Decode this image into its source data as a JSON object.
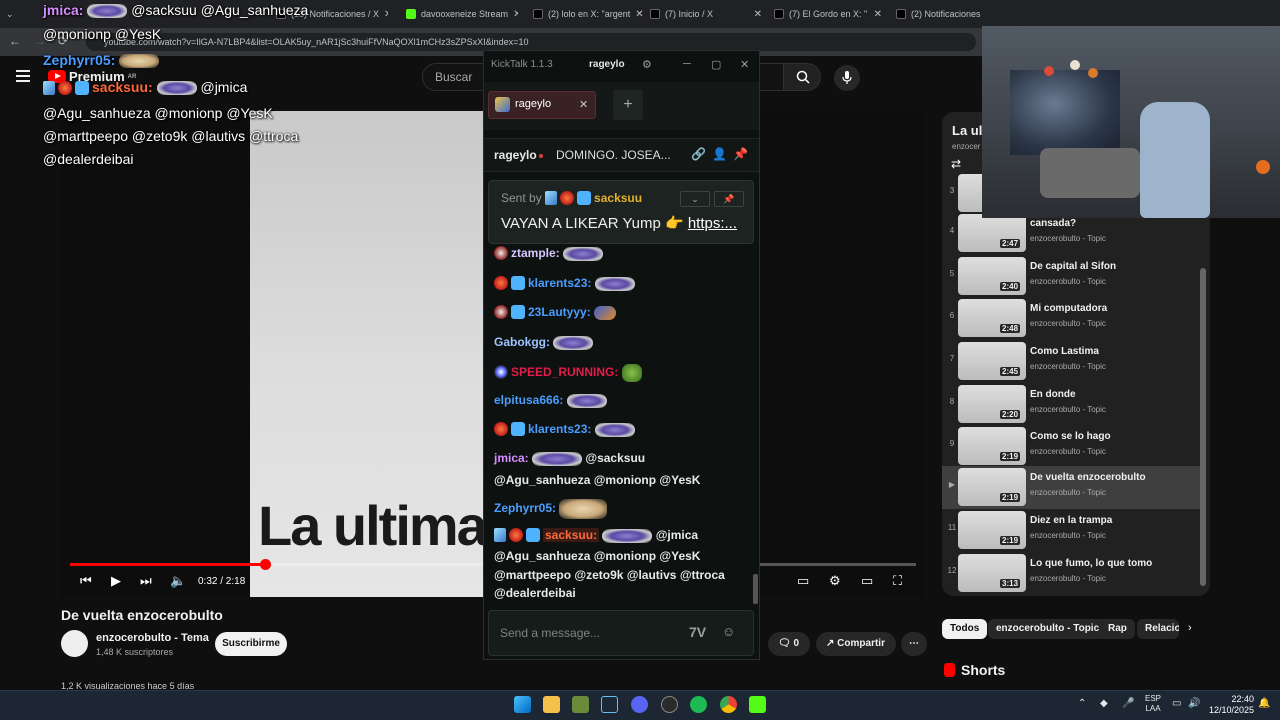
{
  "browser": {
    "tabs": [
      {
        "label": "(2) lolo en X: \"argent",
        "color": "#1d1d1d"
      },
      {
        "label": "(7) Inicio / X",
        "color": "#1d1d1d"
      },
      {
        "label": "(7) El Gordo en X: \"",
        "color": "#1d1d1d"
      },
      {
        "label": "(2) Notificaciones / X",
        "color": "#1d1d1d"
      },
      {
        "label": "davooxeneize Stream",
        "color": "#53fc18"
      },
      {
        "label": "(13) Notificaciones / X",
        "color": "#1d1d1d"
      }
    ],
    "url": "youtube.com/watch?v=IlGA-N7LBP4&list=OLAK5uy_nAR1jSc3huiFfVNaQOXl1mCHz3sZPSxXI&index=10"
  },
  "youtube": {
    "logo": "Premium",
    "logo_region": "AR",
    "search_placeholder": "Buscar",
    "cover_text": "La ultima",
    "time": "0:32 / 2:18",
    "progress_fraction": 0.233,
    "video_title": "De vuelta enzocerobulto",
    "channel_name": "enzocerobulto - Tema",
    "subscribers": "1,48 K suscriptores",
    "subscribe_label": "Suscribirme",
    "comment_count": "0",
    "share_label": "Compartir",
    "views_line": "1,2 K visualizaciones  hace 5 días"
  },
  "overlay_chat": {
    "line1_name": "jmica:",
    "line1_text": "@sacksuu @Agu_sanhueza",
    "line2_text": "@monionp @YesK",
    "line3_name": "Zephyrr05:",
    "line4_name": "sacksuu:",
    "line4_text": "@jmica",
    "line5_text": "@Agu_sanhueza @monionp @YesK",
    "line6_text": "@marttpeepo @zeto9k @lautivs @ttroca",
    "line7_text": "@dealerdeibai"
  },
  "playlist": {
    "title": "La ul",
    "subtitle": "enzocer",
    "items": [
      {
        "num": "3",
        "title": "",
        "channel": "",
        "duration": ""
      },
      {
        "num": "4",
        "title": "cansada?",
        "channel": "enzocerobulto - Topic",
        "duration": "2:47"
      },
      {
        "num": "5",
        "title": "De capital al Sifon",
        "channel": "enzocerobulto - Topic",
        "duration": "2:40"
      },
      {
        "num": "6",
        "title": "Mi computadora",
        "channel": "enzocerobulto - Topic",
        "duration": "2:48"
      },
      {
        "num": "7",
        "title": "Como Lastima",
        "channel": "enzocerobulto - Topic",
        "duration": "2:45"
      },
      {
        "num": "8",
        "title": "En donde",
        "channel": "enzocerobulto - Topic",
        "duration": "2:20"
      },
      {
        "num": "9",
        "title": "Como se lo hago",
        "channel": "enzocerobulto - Topic",
        "duration": "2:19"
      },
      {
        "num": "▶",
        "title": "De vuelta enzocerobulto",
        "channel": "enzocerobulto - Topic",
        "duration": "2:19"
      },
      {
        "num": "11",
        "title": "Diez en la trampa",
        "channel": "enzocerobulto - Topic",
        "duration": "2:19"
      },
      {
        "num": "12",
        "title": "Lo que fumo, lo que tomo",
        "channel": "enzocerobulto - Topic",
        "duration": "3:13"
      }
    ],
    "chips": [
      "Todos",
      "enzocerobulto - Topic",
      "Rap",
      "Relacio"
    ],
    "shorts_label": "Shorts"
  },
  "kicktalk": {
    "app_title": "KickTalk 1.1.3",
    "account": "rageylo",
    "tab_name": "rageylo",
    "channel": "rageylo",
    "stream_title": "DOMINGO. JOSEA...",
    "pinned_by_label": "Sent by",
    "pinned_user": "sacksuu",
    "pinned_text": "VAYAN A LIKEAR Yump 👉",
    "pinned_link": "https:...",
    "messages": [
      {
        "user": "ztample:",
        "color": "#d9c7ff",
        "text": ""
      },
      {
        "user": "klarents23:",
        "color": "#4a9eff",
        "text": ""
      },
      {
        "user": "23Lautyyy:",
        "color": "#4a9eff",
        "text": ""
      },
      {
        "user": "Gabokgg:",
        "color": "#9ec3ff",
        "text": ""
      },
      {
        "user": "SPEED_RUNNING:",
        "color": "#e11d48",
        "text": ""
      },
      {
        "user": "elpitusa666:",
        "color": "#4a9eff",
        "text": ""
      },
      {
        "user": "klarents23:",
        "color": "#4a9eff",
        "text": ""
      },
      {
        "user": "jmica:",
        "color": "#d58cff",
        "text": "@sacksuu"
      },
      {
        "user": "",
        "color": "#e9e9e9",
        "text": "@Agu_sanhueza @monionp @YesK"
      },
      {
        "user": "Zephyrr05:",
        "color": "#4a9eff",
        "text": ""
      },
      {
        "user": "sacksuu:",
        "color": "#ff6a3a",
        "text": "@jmica"
      },
      {
        "user": "",
        "color": "#e9e9e9",
        "text": "@Agu_sanhueza @monionp @YesK"
      },
      {
        "user": "",
        "color": "#e9e9e9",
        "text": "@marttpeepo @zeto9k @lautivs @ttroca"
      },
      {
        "user": "",
        "color": "#e9e9e9",
        "text": "@dealerdeibai"
      }
    ],
    "input_placeholder": "Send a message..."
  },
  "taskbar": {
    "lang_top": "ESP",
    "lang_bottom": "LAA",
    "time": "22:40",
    "date": "12/10/2025"
  }
}
